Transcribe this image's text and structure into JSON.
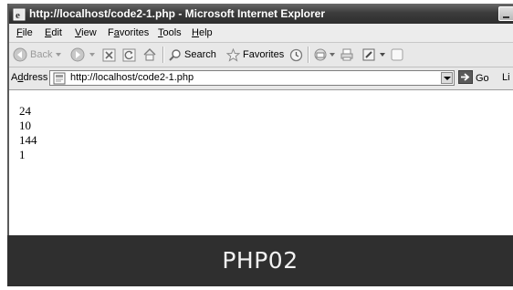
{
  "window": {
    "title": "http://localhost/code2-1.php - Microsoft Internet Explorer"
  },
  "menu": [
    {
      "pre": "",
      "key": "F",
      "post": "ile"
    },
    {
      "pre": "",
      "key": "E",
      "post": "dit"
    },
    {
      "pre": "",
      "key": "V",
      "post": "iew"
    },
    {
      "pre": "F",
      "key": "a",
      "post": "vorites"
    },
    {
      "pre": "",
      "key": "T",
      "post": "ools"
    },
    {
      "pre": "",
      "key": "H",
      "post": "elp"
    }
  ],
  "toolbar": {
    "back_label": "Back",
    "search_label": "Search",
    "favorites_label": "Favorites"
  },
  "address": {
    "label_pre": "A",
    "label_key": "d",
    "label_post": "dress",
    "url": "http://localhost/code2-1.php",
    "go_label": "Go",
    "links_label": "Li"
  },
  "page": {
    "lines": [
      "24",
      "10",
      "144",
      "1"
    ]
  },
  "caption": "PHP02",
  "colors": {
    "titlebar": "#3c3c3c",
    "chrome": "#e8e8e8",
    "caption_bg": "#2f2f2f"
  }
}
